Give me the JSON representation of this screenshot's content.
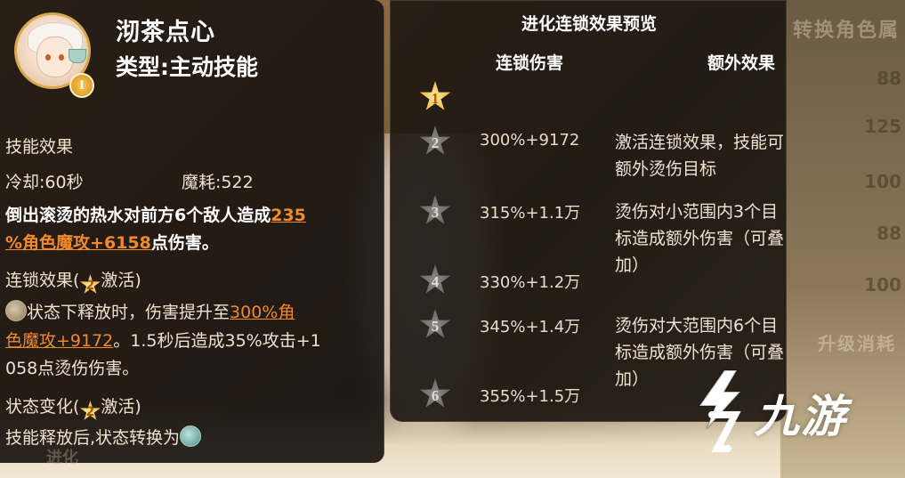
{
  "skill": {
    "name": "沏茶点心",
    "type_label": "类型:主动技能",
    "rank": "I"
  },
  "effect": {
    "heading": "技能效果",
    "cooldown": "冷却:60秒",
    "mana": "魔耗:522",
    "desc_a": "倒出滚烫的热水对前方6个敌人造成",
    "desc_b": "235",
    "desc_c": "%角色魔攻+6158",
    "desc_d": "点伤害。"
  },
  "chain": {
    "label": "连锁效果(",
    "star": "2",
    "activate": "激活)",
    "line1_a": "状态下释放时，伤害提升至",
    "line1_b": "300%角",
    "line2_a": "色魔攻+9172",
    "line2_b": "。1.5秒后造成35%攻击+1",
    "line3": "058点烫伤伤害。"
  },
  "state": {
    "label": "状态变化(",
    "star": "2",
    "activate": "激活)",
    "line1": "技能释放后,状态转换为"
  },
  "preview": {
    "title": "进化连锁效果预览",
    "col_damage": "连锁伤害",
    "col_extra": "额外效果",
    "levels": [
      {
        "level": "1",
        "damage": "",
        "extra": "",
        "active": true
      },
      {
        "level": "2",
        "damage": "300%+9172",
        "extra": "激活连锁效果，技能可额外烫伤目标",
        "active": false
      },
      {
        "level": "3",
        "damage": "315%+1.1万",
        "extra": "烫伤对小范围内3个目标造成额外伤害（可叠加）",
        "active": false
      },
      {
        "level": "4",
        "damage": "330%+1.2万",
        "extra": "",
        "active": false
      },
      {
        "level": "5",
        "damage": "345%+1.4万",
        "extra": "烫伤对大范围内6个目标造成额外伤害（可叠加）",
        "active": false
      },
      {
        "level": "6",
        "damage": "355%+1.5万",
        "extra": "",
        "active": false
      }
    ]
  },
  "background": {
    "right_title": "转换角色属",
    "right_values": [
      "88",
      "125",
      "100",
      "88",
      "100"
    ],
    "right_button": "升级消耗",
    "bottom_left": "进化"
  },
  "watermark": {
    "text": "九游"
  },
  "colors": {
    "highlight": "#f08a2a",
    "panel": "#1c1611",
    "star_gold": "#f0b431",
    "star_grey": "#8d8a86"
  }
}
